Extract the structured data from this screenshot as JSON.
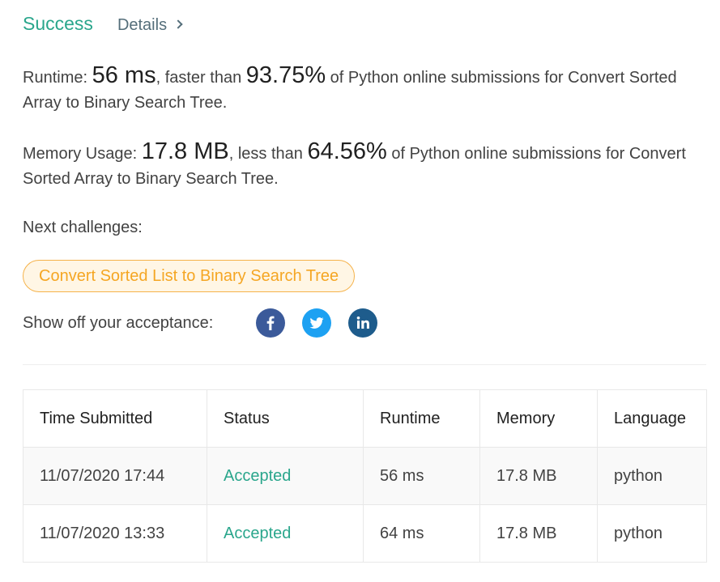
{
  "header": {
    "status": "Success",
    "details_label": "Details"
  },
  "runtime": {
    "label": "Runtime: ",
    "value": "56 ms",
    "mid": ", faster than ",
    "percent": "93.75%",
    "suffix": " of Python online submissions for Convert Sorted Array to Binary Search Tree."
  },
  "memory": {
    "label": "Memory Usage: ",
    "value": "17.8 MB",
    "mid": ", less than ",
    "percent": "64.56%",
    "suffix": " of Python online submissions for Convert Sorted Array to Binary Search Tree."
  },
  "next": {
    "label": "Next challenges:",
    "challenge": "Convert Sorted List to Binary Search Tree"
  },
  "share": {
    "label": "Show off your acceptance:",
    "icons": [
      "facebook-icon",
      "twitter-icon",
      "linkedin-icon"
    ]
  },
  "table": {
    "headers": [
      "Time Submitted",
      "Status",
      "Runtime",
      "Memory",
      "Language"
    ],
    "rows": [
      [
        "11/07/2020 17:44",
        "Accepted",
        "56 ms",
        "17.8 MB",
        "python"
      ],
      [
        "11/07/2020 13:33",
        "Accepted",
        "64 ms",
        "17.8 MB",
        "python"
      ]
    ]
  },
  "colors": {
    "success": "#2aa68c",
    "challenge_text": "#f5a623",
    "challenge_bg": "#fff6e5",
    "facebook": "#3b5a9a",
    "twitter": "#1da1f2",
    "linkedin": "#1e5c8c"
  }
}
